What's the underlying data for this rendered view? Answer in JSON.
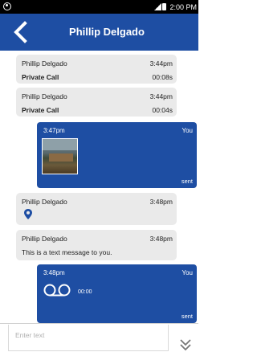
{
  "status_bar": {
    "time": "2:00 PM"
  },
  "header": {
    "title": "Phillip Delgado"
  },
  "messages": [
    {
      "name": "Phillip Delgado",
      "time": "3:44pm",
      "label": "Private Call",
      "duration": "00:08s"
    },
    {
      "name": "Phillip Delgado",
      "time": "3:44pm",
      "label": "Private Call",
      "duration": "00:04s"
    },
    {
      "time": "3:47pm",
      "sender": "You",
      "status": "sent"
    },
    {
      "name": "Phillip Delgado",
      "time": "3:48pm"
    },
    {
      "name": "Phillip Delgado",
      "time": "3:48pm",
      "text": "This is a text message to you."
    },
    {
      "time": "3:48pm",
      "sender": "You",
      "voicemail_duration": "00:00",
      "status": "sent"
    }
  ],
  "composer": {
    "placeholder": "Enter text"
  },
  "colors": {
    "primary": "#1e4ea3",
    "incoming_bubble": "#eaeaea",
    "status_bar": "#000000"
  }
}
